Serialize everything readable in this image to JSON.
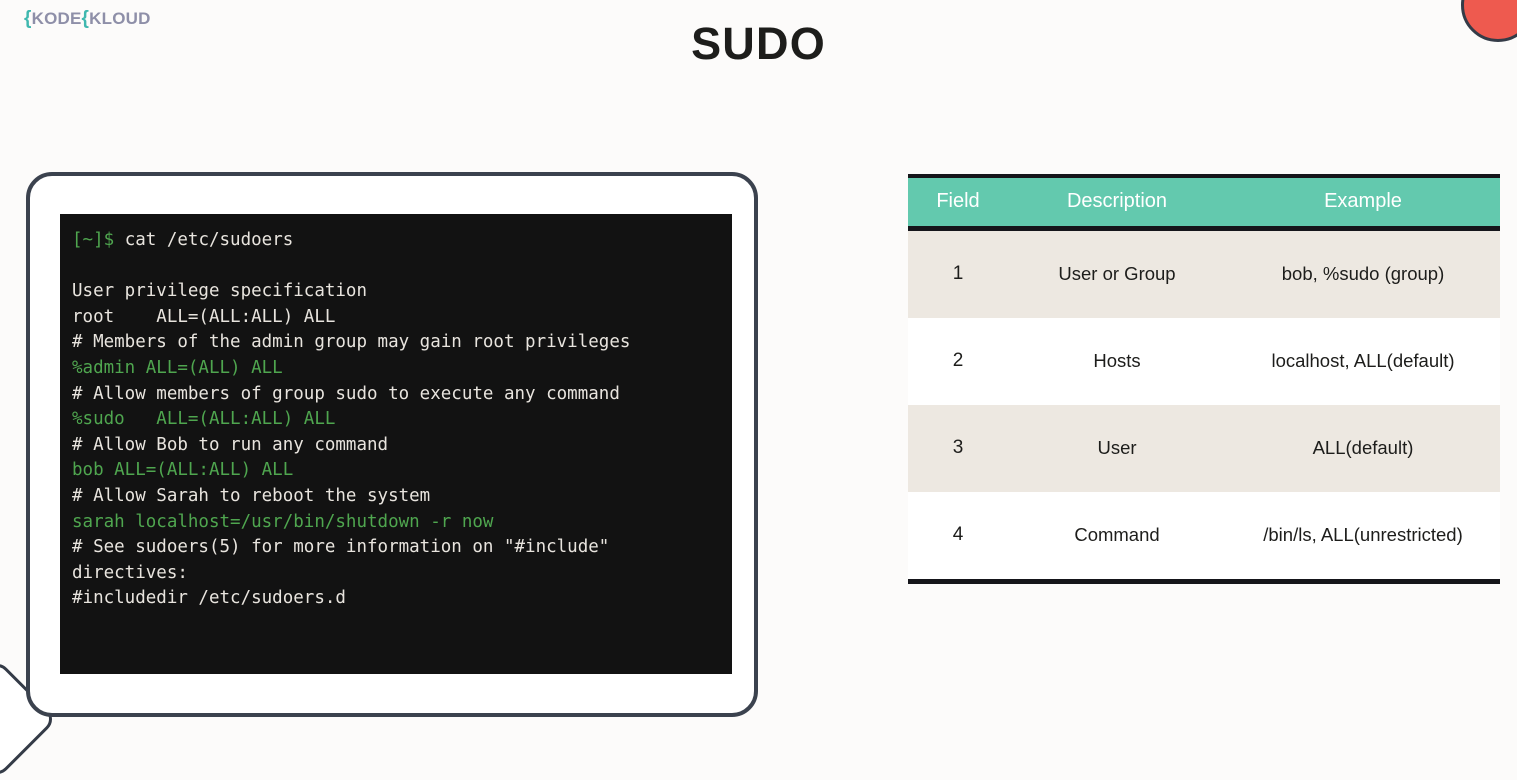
{
  "brand": {
    "name": "KODEKLOUD",
    "part1": "K",
    "part2": "ODE",
    "part3": "K",
    "part4": "LOUD"
  },
  "title": "SUDO",
  "terminal": {
    "prompt": "[~]$",
    "command": "cat /etc/sudoers",
    "lines": [
      {
        "text": "User privilege specification",
        "color": "normal"
      },
      {
        "text": "root    ALL=(ALL:ALL) ALL",
        "color": "normal"
      },
      {
        "text": "# Members of the admin group may gain root privileges",
        "color": "normal"
      },
      {
        "text": "%admin ALL=(ALL) ALL",
        "color": "green"
      },
      {
        "text": "# Allow members of group sudo to execute any command",
        "color": "normal"
      },
      {
        "text": "%sudo   ALL=(ALL:ALL) ALL",
        "color": "green"
      },
      {
        "text": "# Allow Bob to run any command",
        "color": "normal"
      },
      {
        "text": "bob ALL=(ALL:ALL) ALL",
        "color": "green"
      },
      {
        "text": "# Allow Sarah to reboot the system",
        "color": "normal"
      },
      {
        "text": "sarah localhost=/usr/bin/shutdown -r now",
        "color": "green"
      },
      {
        "text": "# See sudoers(5) for more information on \"#include\" directives:",
        "color": "normal"
      },
      {
        "text": "#includedir /etc/sudoers.d",
        "color": "normal"
      }
    ]
  },
  "table": {
    "headers": [
      "Field",
      "Description",
      "Example"
    ],
    "rows": [
      {
        "field": "1",
        "description": "User or Group",
        "example": "bob, %sudo (group)"
      },
      {
        "field": "2",
        "description": "Hosts",
        "example": "localhost, ALL(default)"
      },
      {
        "field": "3",
        "description": "User",
        "example": "ALL(default)"
      },
      {
        "field": "4",
        "description": "Command",
        "example": "/bin/ls, ALL(unrestricted)"
      }
    ]
  },
  "colors": {
    "header_teal": "#63C9AE",
    "row_shade": "#EDE8E1",
    "terminal_bg": "#121212",
    "terminal_green": "#4FA64F",
    "frame_dark": "#3B424E",
    "accent_red": "#EE5A4F"
  }
}
